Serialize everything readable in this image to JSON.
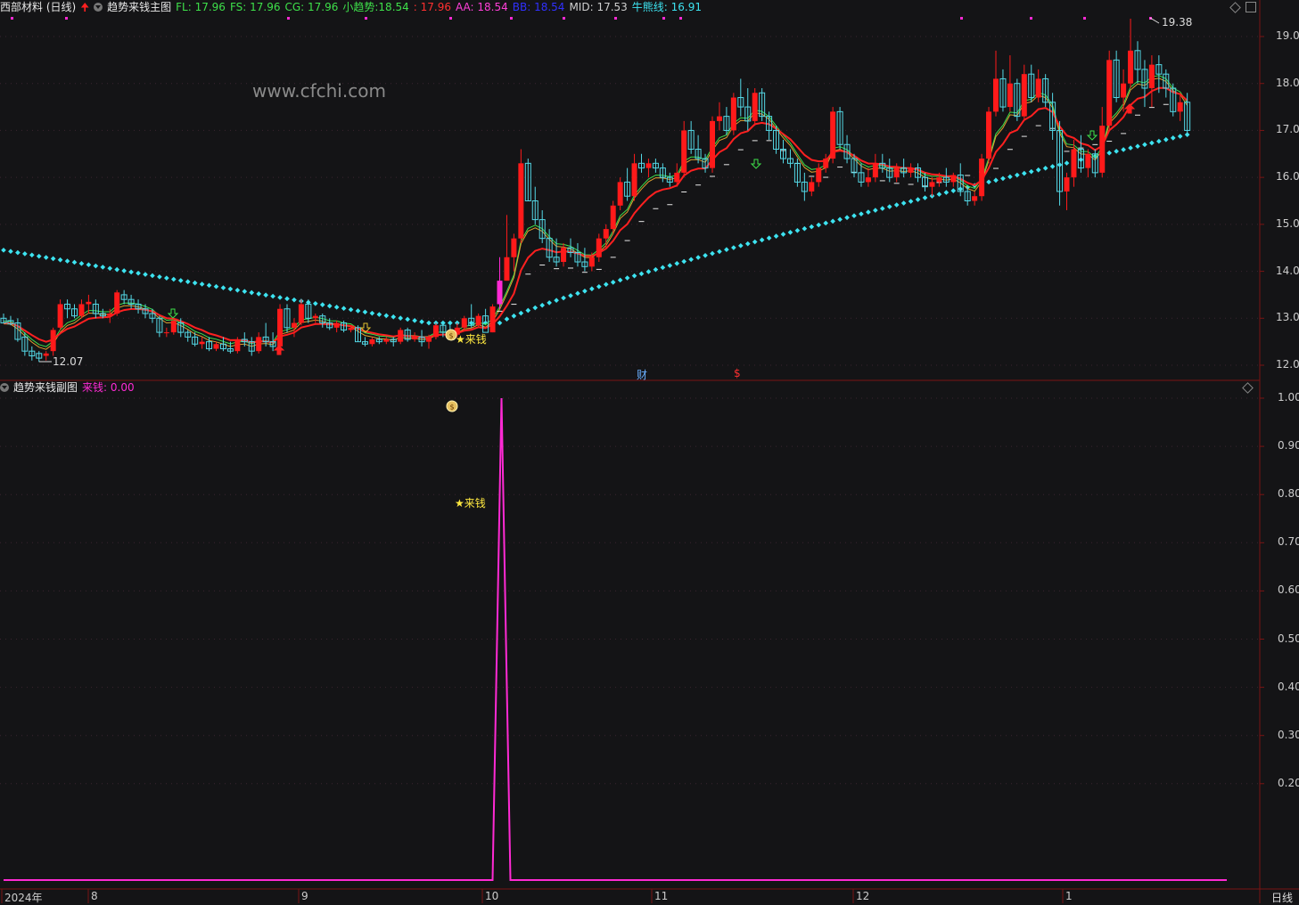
{
  "header": {
    "stock": "西部材料 (日线)",
    "indicator_name": "趋势来钱主图",
    "fl": "FL: 17.96",
    "fs": "FS: 17.96",
    "cg": "CG: 17.96",
    "xqs_label": "小趋势:",
    "xqs_v1": "18.54",
    "xqs_v2": ": 17.96",
    "aa": "AA: 18.54",
    "bb": "BB: 18.54",
    "mid": "MID: 17.53",
    "bear": "牛熊线: 16.91"
  },
  "watermark": "www.cfchi.com",
  "sub_header": {
    "name": "趋势来钱副图",
    "value": "来钱: 0.00"
  },
  "annotations": {
    "high": "19.38",
    "low": "12.07",
    "signal": "★来钱",
    "signal_sub": "★来钱",
    "cai": "财",
    "dollar": "$",
    "period": "日线"
  },
  "colors": {
    "up": "#ff1a1a",
    "down": "#54d8e6",
    "mid": "#ff2020",
    "bear_dots": "#3de3f0",
    "signal": "#ff2ad4",
    "grid": "#3a2430",
    "axis": "#8a1a1a"
  },
  "main_yaxis": [
    "19.00",
    "18.00",
    "17.00",
    "16.00",
    "15.00",
    "14.00",
    "13.00",
    "12.00"
  ],
  "sub_yaxis": [
    "1.00",
    "0.90",
    "0.80",
    "0.70",
    "0.60",
    "0.50",
    "0.40",
    "0.30",
    "0.20"
  ],
  "xaxis": [
    "2024年",
    "8",
    "9",
    "10",
    "11",
    "12",
    "1"
  ],
  "chart_data": [
    {
      "type": "candlestick",
      "title": "趋势来钱主图",
      "ylim": [
        11.7,
        19.6
      ],
      "notes": "OHLC values estimated from axis; 172 daily bars Jul 2024 - Jan 2025",
      "ohlc": [
        [
          13.0,
          13.1,
          12.9,
          12.9
        ],
        [
          12.95,
          13.05,
          12.85,
          12.88
        ],
        [
          12.9,
          13.0,
          12.5,
          12.55
        ],
        [
          12.6,
          12.7,
          12.2,
          12.3
        ],
        [
          12.3,
          12.4,
          12.1,
          12.2
        ],
        [
          12.25,
          12.3,
          12.07,
          12.15
        ],
        [
          12.2,
          12.3,
          12.1,
          12.25
        ],
        [
          12.3,
          12.8,
          12.2,
          12.75
        ],
        [
          12.8,
          13.4,
          12.75,
          13.3
        ],
        [
          13.3,
          13.4,
          13.0,
          13.2
        ],
        [
          13.2,
          13.3,
          13.0,
          13.05
        ],
        [
          13.05,
          13.4,
          13.0,
          13.3
        ],
        [
          13.3,
          13.5,
          13.1,
          13.35
        ],
        [
          13.3,
          13.4,
          13.0,
          13.1
        ],
        [
          13.1,
          13.2,
          13.0,
          13.05
        ],
        [
          13.05,
          13.2,
          12.9,
          13.1
        ],
        [
          13.1,
          13.6,
          13.05,
          13.55
        ],
        [
          13.5,
          13.6,
          13.3,
          13.4
        ],
        [
          13.4,
          13.5,
          13.2,
          13.3
        ],
        [
          13.3,
          13.4,
          13.1,
          13.2
        ],
        [
          13.2,
          13.3,
          13.0,
          13.1
        ],
        [
          13.1,
          13.2,
          12.9,
          13.0
        ],
        [
          13.0,
          13.05,
          12.6,
          12.7
        ],
        [
          12.7,
          12.8,
          12.6,
          12.7
        ],
        [
          12.7,
          13.0,
          12.65,
          12.95
        ],
        [
          12.9,
          13.0,
          12.6,
          12.7
        ],
        [
          12.7,
          12.75,
          12.5,
          12.6
        ],
        [
          12.6,
          12.7,
          12.4,
          12.45
        ],
        [
          12.45,
          12.6,
          12.35,
          12.5
        ],
        [
          12.5,
          12.6,
          12.3,
          12.35
        ],
        [
          12.35,
          12.5,
          12.3,
          12.45
        ],
        [
          12.45,
          12.6,
          12.3,
          12.35
        ],
        [
          12.35,
          12.5,
          12.25,
          12.3
        ],
        [
          12.3,
          12.6,
          12.25,
          12.55
        ],
        [
          12.55,
          12.7,
          12.4,
          12.5
        ],
        [
          12.5,
          12.6,
          12.2,
          12.3
        ],
        [
          12.3,
          12.7,
          12.25,
          12.6
        ],
        [
          12.6,
          12.9,
          12.4,
          12.5
        ],
        [
          12.5,
          12.7,
          12.3,
          12.4
        ],
        [
          12.4,
          13.3,
          12.4,
          13.2
        ],
        [
          13.2,
          13.3,
          12.7,
          12.8
        ],
        [
          12.8,
          13.0,
          12.6,
          12.9
        ],
        [
          12.9,
          13.4,
          12.85,
          13.3
        ],
        [
          13.3,
          13.4,
          12.9,
          13.0
        ],
        [
          13.0,
          13.1,
          12.9,
          13.05
        ],
        [
          13.05,
          13.1,
          12.8,
          12.9
        ],
        [
          12.9,
          13.0,
          12.75,
          12.8
        ],
        [
          12.8,
          12.95,
          12.7,
          12.9
        ],
        [
          12.9,
          12.95,
          12.7,
          12.75
        ],
        [
          12.75,
          12.85,
          12.7,
          12.8
        ],
        [
          12.8,
          12.85,
          12.5,
          12.5
        ],
        [
          12.5,
          12.6,
          12.4,
          12.45
        ],
        [
          12.45,
          12.6,
          12.4,
          12.55
        ],
        [
          12.55,
          12.6,
          12.45,
          12.5
        ],
        [
          12.5,
          12.6,
          12.45,
          12.55
        ],
        [
          12.55,
          12.6,
          12.4,
          12.5
        ],
        [
          12.5,
          12.8,
          12.45,
          12.75
        ],
        [
          12.75,
          12.8,
          12.5,
          12.55
        ],
        [
          12.55,
          12.7,
          12.5,
          12.6
        ],
        [
          12.6,
          12.75,
          12.4,
          12.5
        ],
        [
          12.5,
          12.65,
          12.35,
          12.6
        ],
        [
          12.6,
          12.9,
          12.55,
          12.85
        ],
        [
          12.85,
          12.9,
          12.6,
          12.7
        ],
        [
          12.7,
          12.85,
          12.6,
          12.65
        ],
        [
          12.65,
          12.9,
          12.6,
          12.8
        ],
        [
          12.8,
          13.05,
          12.75,
          13.0
        ],
        [
          13.0,
          13.3,
          12.8,
          12.85
        ],
        [
          12.85,
          13.1,
          12.8,
          13.05
        ],
        [
          13.05,
          13.2,
          12.9,
          12.7
        ],
        [
          12.7,
          13.3,
          12.7,
          13.25
        ],
        [
          13.3,
          14.3,
          13.2,
          13.8
        ],
        [
          13.8,
          15.2,
          13.8,
          14.3
        ],
        [
          14.3,
          14.8,
          14.0,
          14.7
        ],
        [
          14.7,
          16.6,
          14.6,
          16.3
        ],
        [
          16.3,
          16.4,
          15.5,
          15.5
        ],
        [
          15.5,
          15.8,
          15.0,
          15.1
        ],
        [
          15.1,
          15.3,
          14.6,
          14.7
        ],
        [
          14.7,
          14.9,
          14.2,
          14.3
        ],
        [
          14.3,
          14.7,
          14.1,
          14.2
        ],
        [
          14.2,
          14.6,
          14.1,
          14.5
        ],
        [
          14.5,
          14.7,
          14.3,
          14.4
        ],
        [
          14.4,
          14.6,
          14.1,
          14.2
        ],
        [
          14.2,
          14.5,
          14.0,
          14.1
        ],
        [
          14.1,
          14.4,
          14.0,
          14.3
        ],
        [
          14.3,
          14.8,
          14.2,
          14.7
        ],
        [
          14.7,
          15.0,
          14.5,
          14.9
        ],
        [
          14.9,
          15.5,
          14.8,
          15.4
        ],
        [
          15.4,
          16.0,
          15.3,
          15.9
        ],
        [
          15.9,
          16.2,
          15.5,
          15.6
        ],
        [
          15.6,
          16.5,
          15.5,
          16.3
        ],
        [
          16.3,
          16.5,
          16.1,
          16.2
        ],
        [
          16.2,
          16.4,
          16.0,
          16.3
        ],
        [
          16.3,
          16.4,
          16.1,
          16.2
        ],
        [
          16.2,
          16.3,
          15.9,
          16.0
        ],
        [
          16.0,
          16.1,
          15.8,
          15.9
        ],
        [
          15.9,
          16.3,
          15.8,
          16.1
        ],
        [
          16.1,
          17.2,
          16.0,
          17.0
        ],
        [
          17.0,
          17.2,
          16.5,
          16.6
        ],
        [
          16.6,
          16.9,
          16.3,
          16.4
        ],
        [
          16.4,
          16.5,
          16.1,
          16.2
        ],
        [
          16.2,
          17.3,
          16.1,
          17.2
        ],
        [
          17.2,
          17.6,
          17.0,
          17.3
        ],
        [
          17.3,
          17.5,
          16.9,
          17.0
        ],
        [
          17.0,
          17.8,
          16.9,
          17.7
        ],
        [
          17.7,
          18.1,
          17.3,
          17.5
        ],
        [
          17.5,
          17.9,
          17.0,
          17.2
        ],
        [
          17.2,
          17.9,
          17.1,
          17.8
        ],
        [
          17.8,
          17.9,
          17.2,
          17.3
        ],
        [
          17.3,
          17.4,
          16.8,
          17.0
        ],
        [
          17.0,
          17.1,
          16.5,
          16.6
        ],
        [
          16.6,
          16.8,
          16.3,
          16.4
        ],
        [
          16.4,
          16.6,
          16.2,
          16.3
        ],
        [
          16.3,
          16.4,
          15.8,
          15.9
        ],
        [
          15.9,
          16.1,
          15.5,
          15.7
        ],
        [
          15.7,
          16.0,
          15.6,
          15.9
        ],
        [
          15.9,
          16.3,
          15.8,
          16.2
        ],
        [
          16.2,
          16.5,
          16.1,
          16.4
        ],
        [
          16.4,
          17.5,
          16.3,
          17.4
        ],
        [
          17.4,
          17.5,
          16.6,
          16.7
        ],
        [
          16.7,
          16.9,
          16.3,
          16.4
        ],
        [
          16.4,
          16.5,
          16.0,
          16.1
        ],
        [
          16.1,
          16.3,
          15.8,
          15.9
        ],
        [
          15.9,
          16.2,
          15.8,
          16.0
        ],
        [
          16.0,
          16.5,
          15.9,
          16.3
        ],
        [
          16.3,
          16.5,
          16.1,
          16.2
        ],
        [
          16.2,
          16.4,
          15.9,
          16.0
        ],
        [
          16.0,
          16.3,
          15.9,
          16.2
        ],
        [
          16.2,
          16.4,
          16.0,
          16.1
        ],
        [
          16.1,
          16.3,
          16.0,
          16.2
        ],
        [
          16.2,
          16.3,
          15.9,
          16.0
        ],
        [
          16.0,
          16.1,
          15.7,
          15.8
        ],
        [
          15.8,
          16.0,
          15.6,
          15.9
        ],
        [
          15.9,
          16.1,
          15.8,
          16.0
        ],
        [
          16.0,
          16.2,
          15.8,
          15.9
        ],
        [
          15.9,
          16.1,
          15.8,
          16.05
        ],
        [
          16.05,
          16.3,
          15.6,
          15.7
        ],
        [
          15.7,
          15.8,
          15.4,
          15.5
        ],
        [
          15.5,
          15.7,
          15.4,
          15.6
        ],
        [
          15.6,
          16.5,
          15.5,
          16.4
        ],
        [
          16.4,
          17.5,
          16.3,
          17.4
        ],
        [
          17.4,
          18.7,
          17.3,
          18.1
        ],
        [
          18.1,
          18.3,
          17.4,
          17.5
        ],
        [
          17.5,
          18.6,
          17.4,
          18.0
        ],
        [
          18.0,
          18.1,
          17.2,
          17.3
        ],
        [
          17.3,
          18.4,
          17.2,
          18.2
        ],
        [
          18.2,
          18.4,
          17.6,
          17.7
        ],
        [
          17.7,
          18.3,
          17.6,
          18.1
        ],
        [
          18.1,
          18.2,
          17.5,
          17.6
        ],
        [
          17.6,
          17.8,
          16.8,
          17.0
        ],
        [
          17.0,
          17.2,
          15.4,
          15.7
        ],
        [
          15.7,
          16.1,
          15.3,
          16.0
        ],
        [
          16.0,
          16.8,
          15.8,
          16.6
        ],
        [
          16.6,
          16.9,
          16.1,
          16.2
        ],
        [
          16.2,
          16.6,
          16.0,
          16.5
        ],
        [
          16.5,
          16.6,
          16.0,
          16.1
        ],
        [
          16.1,
          17.5,
          16.0,
          17.1
        ],
        [
          17.1,
          18.7,
          17.0,
          18.5
        ],
        [
          18.5,
          18.7,
          17.6,
          17.7
        ],
        [
          17.7,
          18.3,
          17.4,
          18.0
        ],
        [
          18.0,
          19.38,
          17.9,
          18.7
        ],
        [
          18.7,
          18.9,
          18.0,
          18.3
        ],
        [
          18.3,
          18.5,
          17.5,
          17.9
        ],
        [
          17.9,
          18.6,
          17.5,
          18.4
        ],
        [
          18.4,
          18.6,
          17.8,
          18.2
        ],
        [
          18.2,
          18.3,
          17.7,
          17.9
        ],
        [
          17.9,
          18.0,
          17.3,
          17.4
        ],
        [
          17.4,
          17.8,
          17.2,
          17.6
        ],
        [
          17.6,
          17.8,
          16.9,
          17.0
        ]
      ],
      "series": [
        {
          "name": "MID",
          "last": 17.53
        },
        {
          "name": "牛熊线",
          "last": 16.91
        },
        {
          "name": "小趋势",
          "last": 18.54
        },
        {
          "name": "FL",
          "last": 17.96
        },
        {
          "name": "FS",
          "last": 17.96
        },
        {
          "name": "CG",
          "last": 17.96
        }
      ],
      "extremes": {
        "high": 19.38,
        "low": 12.07
      }
    },
    {
      "type": "line",
      "title": "趋势来钱副图",
      "ylim": [
        0,
        1.0
      ],
      "series": [
        {
          "name": "来钱",
          "values": "0 everywhere except 1.00 at signal bar (index 71)",
          "last": 0.0
        }
      ]
    }
  ]
}
